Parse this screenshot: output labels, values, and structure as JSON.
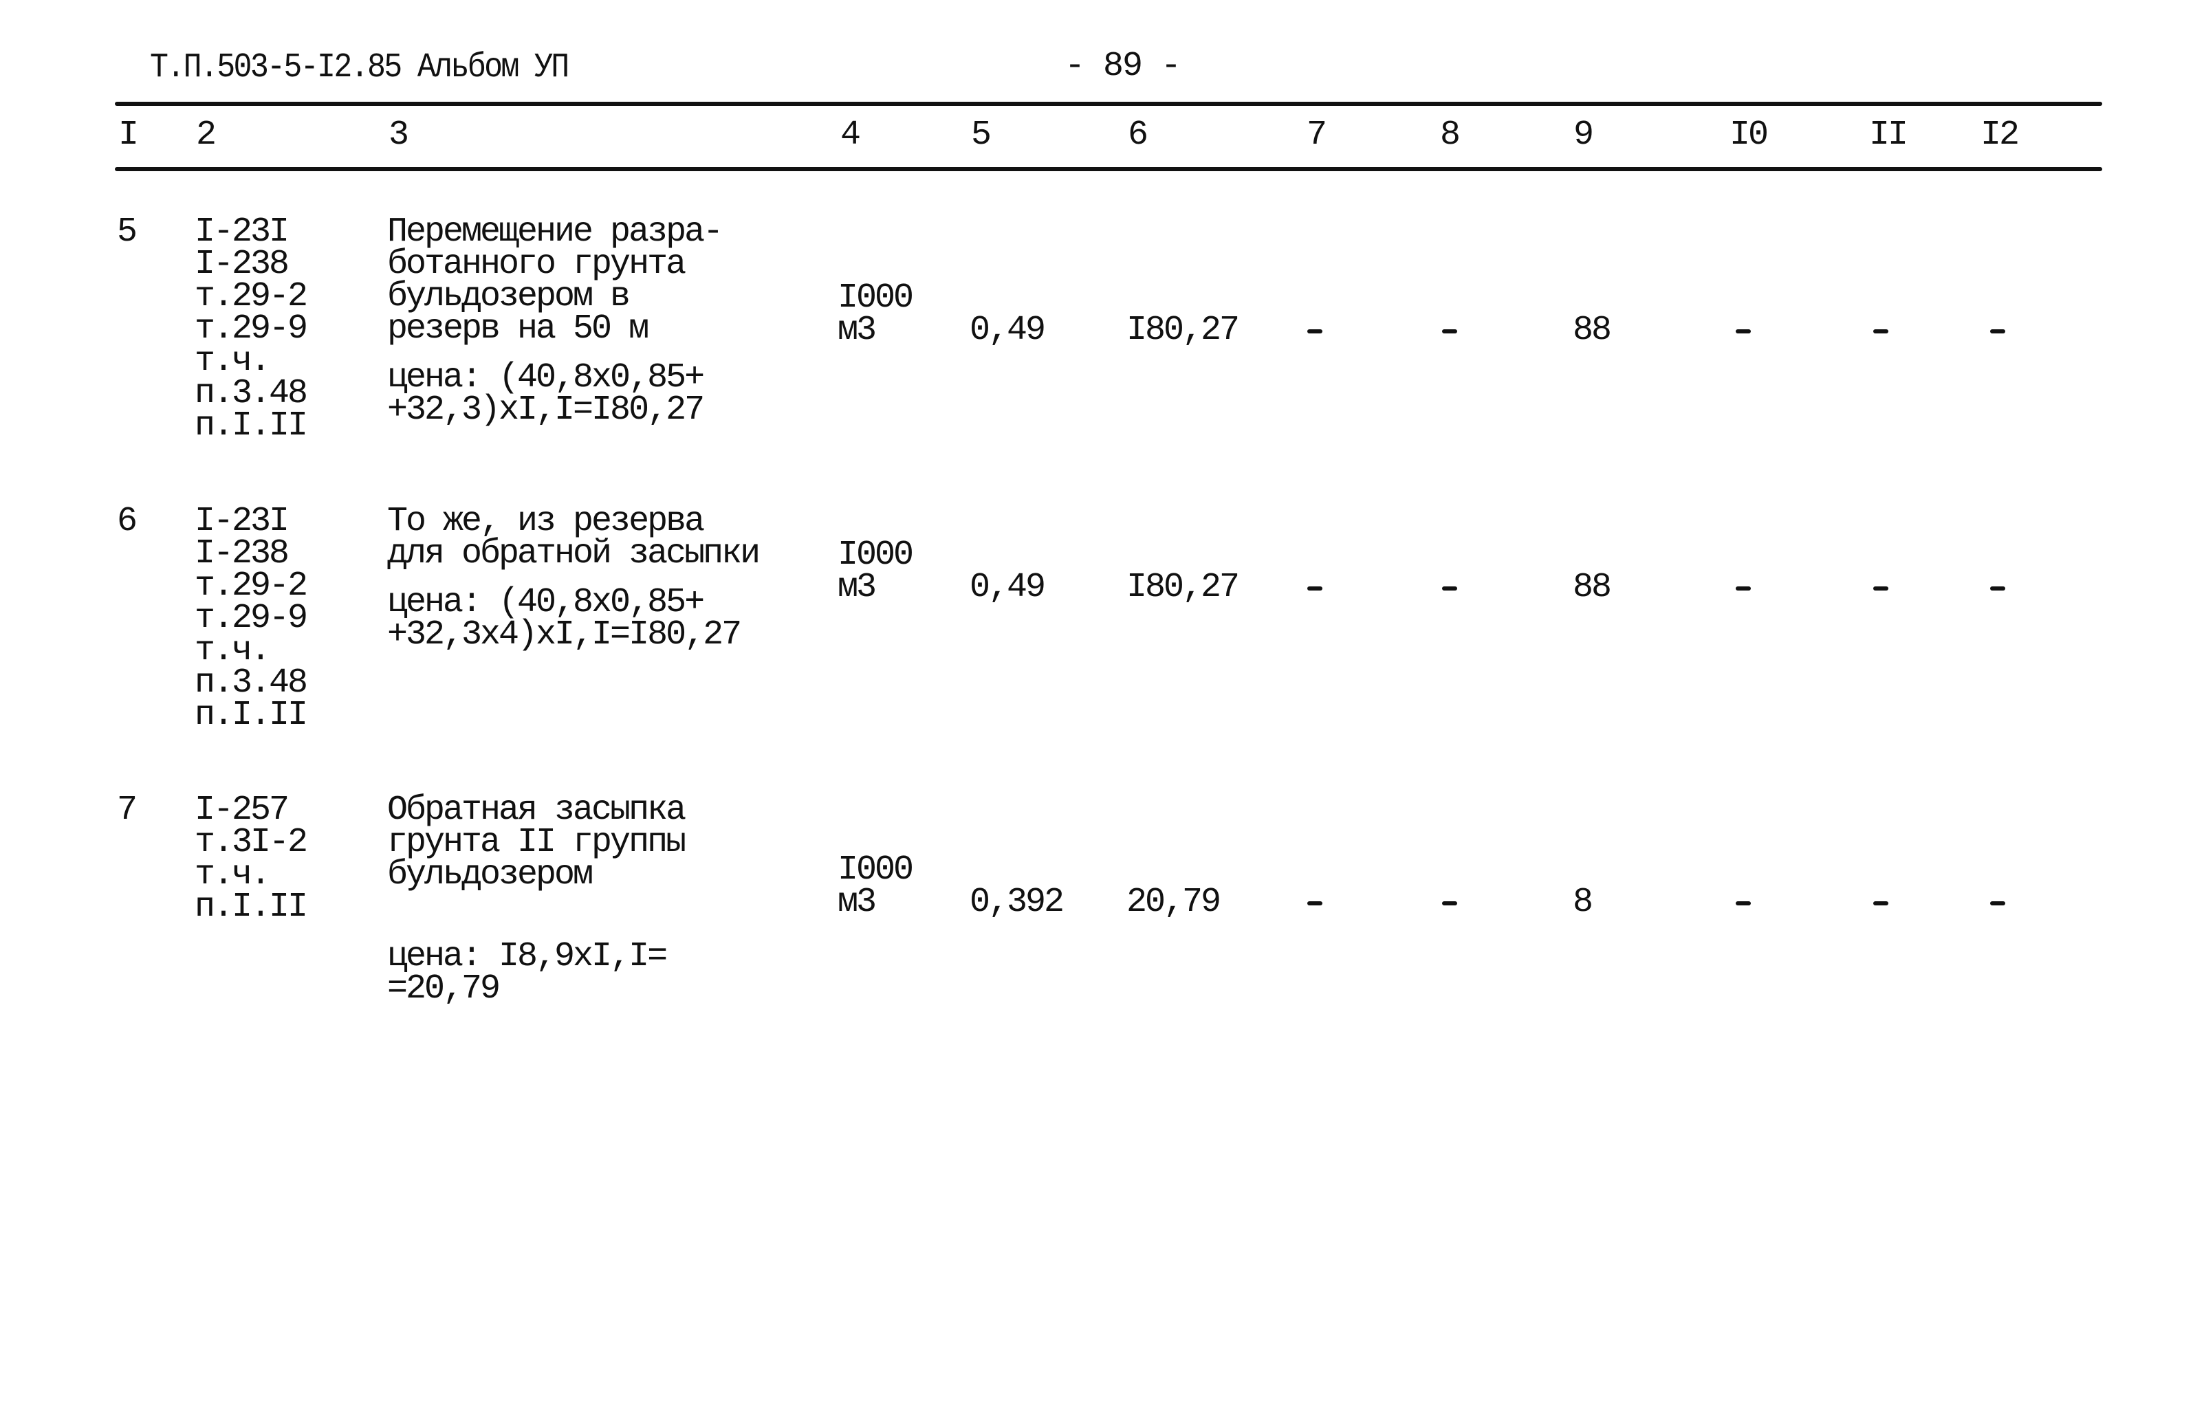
{
  "header": {
    "document_code": "Т.П.503-5-I2.85 Альбом УП",
    "page_number": "- 89 -"
  },
  "columns": [
    "I",
    "2",
    "3",
    "4",
    "5",
    "6",
    "7",
    "8",
    "9",
    "I0",
    "II",
    "I2"
  ],
  "rows": [
    {
      "num": "5",
      "refs": [
        "I-23I",
        "I-238",
        "т.29-2",
        "т.29-9",
        "т.ч.",
        "п.3.48",
        "п.I.II"
      ],
      "description": [
        "Перемещение разра-",
        "ботанного грунта",
        "бульдозером в",
        "резерв на 50 м"
      ],
      "price": [
        "цена: (40,8x0,85+",
        "+32,3)xI,I=I80,27"
      ],
      "unit": [
        "I000",
        "м3"
      ],
      "quantity": "0,49",
      "unit_cost": "I80,27",
      "col7": "-",
      "col8": "-",
      "col9": "88",
      "col10": "-",
      "col11": "-",
      "col12": "-"
    },
    {
      "num": "6",
      "refs": [
        "I-23I",
        "I-238",
        "т.29-2",
        "т.29-9",
        "т.ч.",
        "п.3.48",
        "п.I.II"
      ],
      "description": [
        "То же, из резерва",
        "для обратной засыпки"
      ],
      "price": [
        "цена: (40,8x0,85+",
        "+32,3x4)xI,I=I80,27"
      ],
      "unit": [
        "I000",
        "м3"
      ],
      "quantity": "0,49",
      "unit_cost": "I80,27",
      "col7": "-",
      "col8": "-",
      "col9": "88",
      "col10": "-",
      "col11": "-",
      "col12": "-"
    },
    {
      "num": "7",
      "refs": [
        "I-257",
        "т.3I-2",
        "т.ч.",
        "п.I.II"
      ],
      "description": [
        "Обратная засыпка",
        "грунта II группы",
        "бульдозером"
      ],
      "price": [
        "цена: I8,9xI,I=",
        "=20,79"
      ],
      "unit": [
        "I000",
        "м3"
      ],
      "quantity": "0,392",
      "unit_cost": "20,79",
      "col7": "-",
      "col8": "-",
      "col9": "8",
      "col10": "-",
      "col11": "-",
      "col12": "-"
    }
  ]
}
